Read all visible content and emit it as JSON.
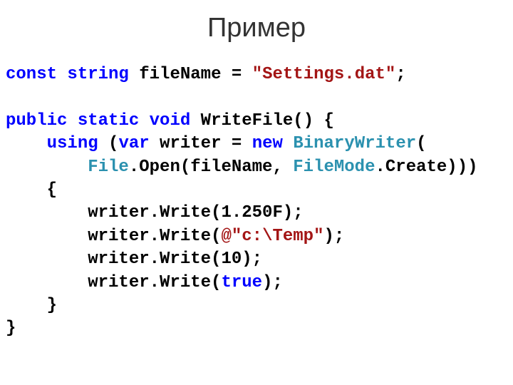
{
  "title": "Пример",
  "code": {
    "l1": {
      "kw1": "const",
      "sp1": " ",
      "kw2": "string",
      "sp2": " ",
      "id1": "fileName = ",
      "str1": "\"Settings.dat\"",
      "end1": ";"
    },
    "blank1": "",
    "l2": {
      "kw1": "public",
      "sp1": " ",
      "kw2": "static",
      "sp2": " ",
      "kw3": "void",
      "sp3": " ",
      "id1": "WriteFile() {"
    },
    "l3": {
      "indent": "    ",
      "kw1": "using",
      "sp1": " (",
      "kw2": "var",
      "sp2": " writer = ",
      "kw3": "new",
      "sp3": " ",
      "type1": "BinaryWriter",
      "end": "("
    },
    "l4": {
      "indent": "        ",
      "type1": "File",
      "mid1": ".Open(fileName, ",
      "type2": "FileMode",
      "end": ".Create)))"
    },
    "l5": {
      "indent": "    ",
      "txt": "{"
    },
    "l6": {
      "indent": "        ",
      "txt": "writer.Write(1.250F);"
    },
    "l7": {
      "indent": "        ",
      "pre": "writer.Write(",
      "str": "@\"c:\\Temp\"",
      "end": ");"
    },
    "l8": {
      "indent": "        ",
      "txt": "writer.Write(10);"
    },
    "l9": {
      "indent": "        ",
      "pre": "writer.Write(",
      "kw": "true",
      "end": ");"
    },
    "l10": {
      "indent": "    ",
      "txt": "}"
    },
    "l11": {
      "txt": "}"
    }
  }
}
